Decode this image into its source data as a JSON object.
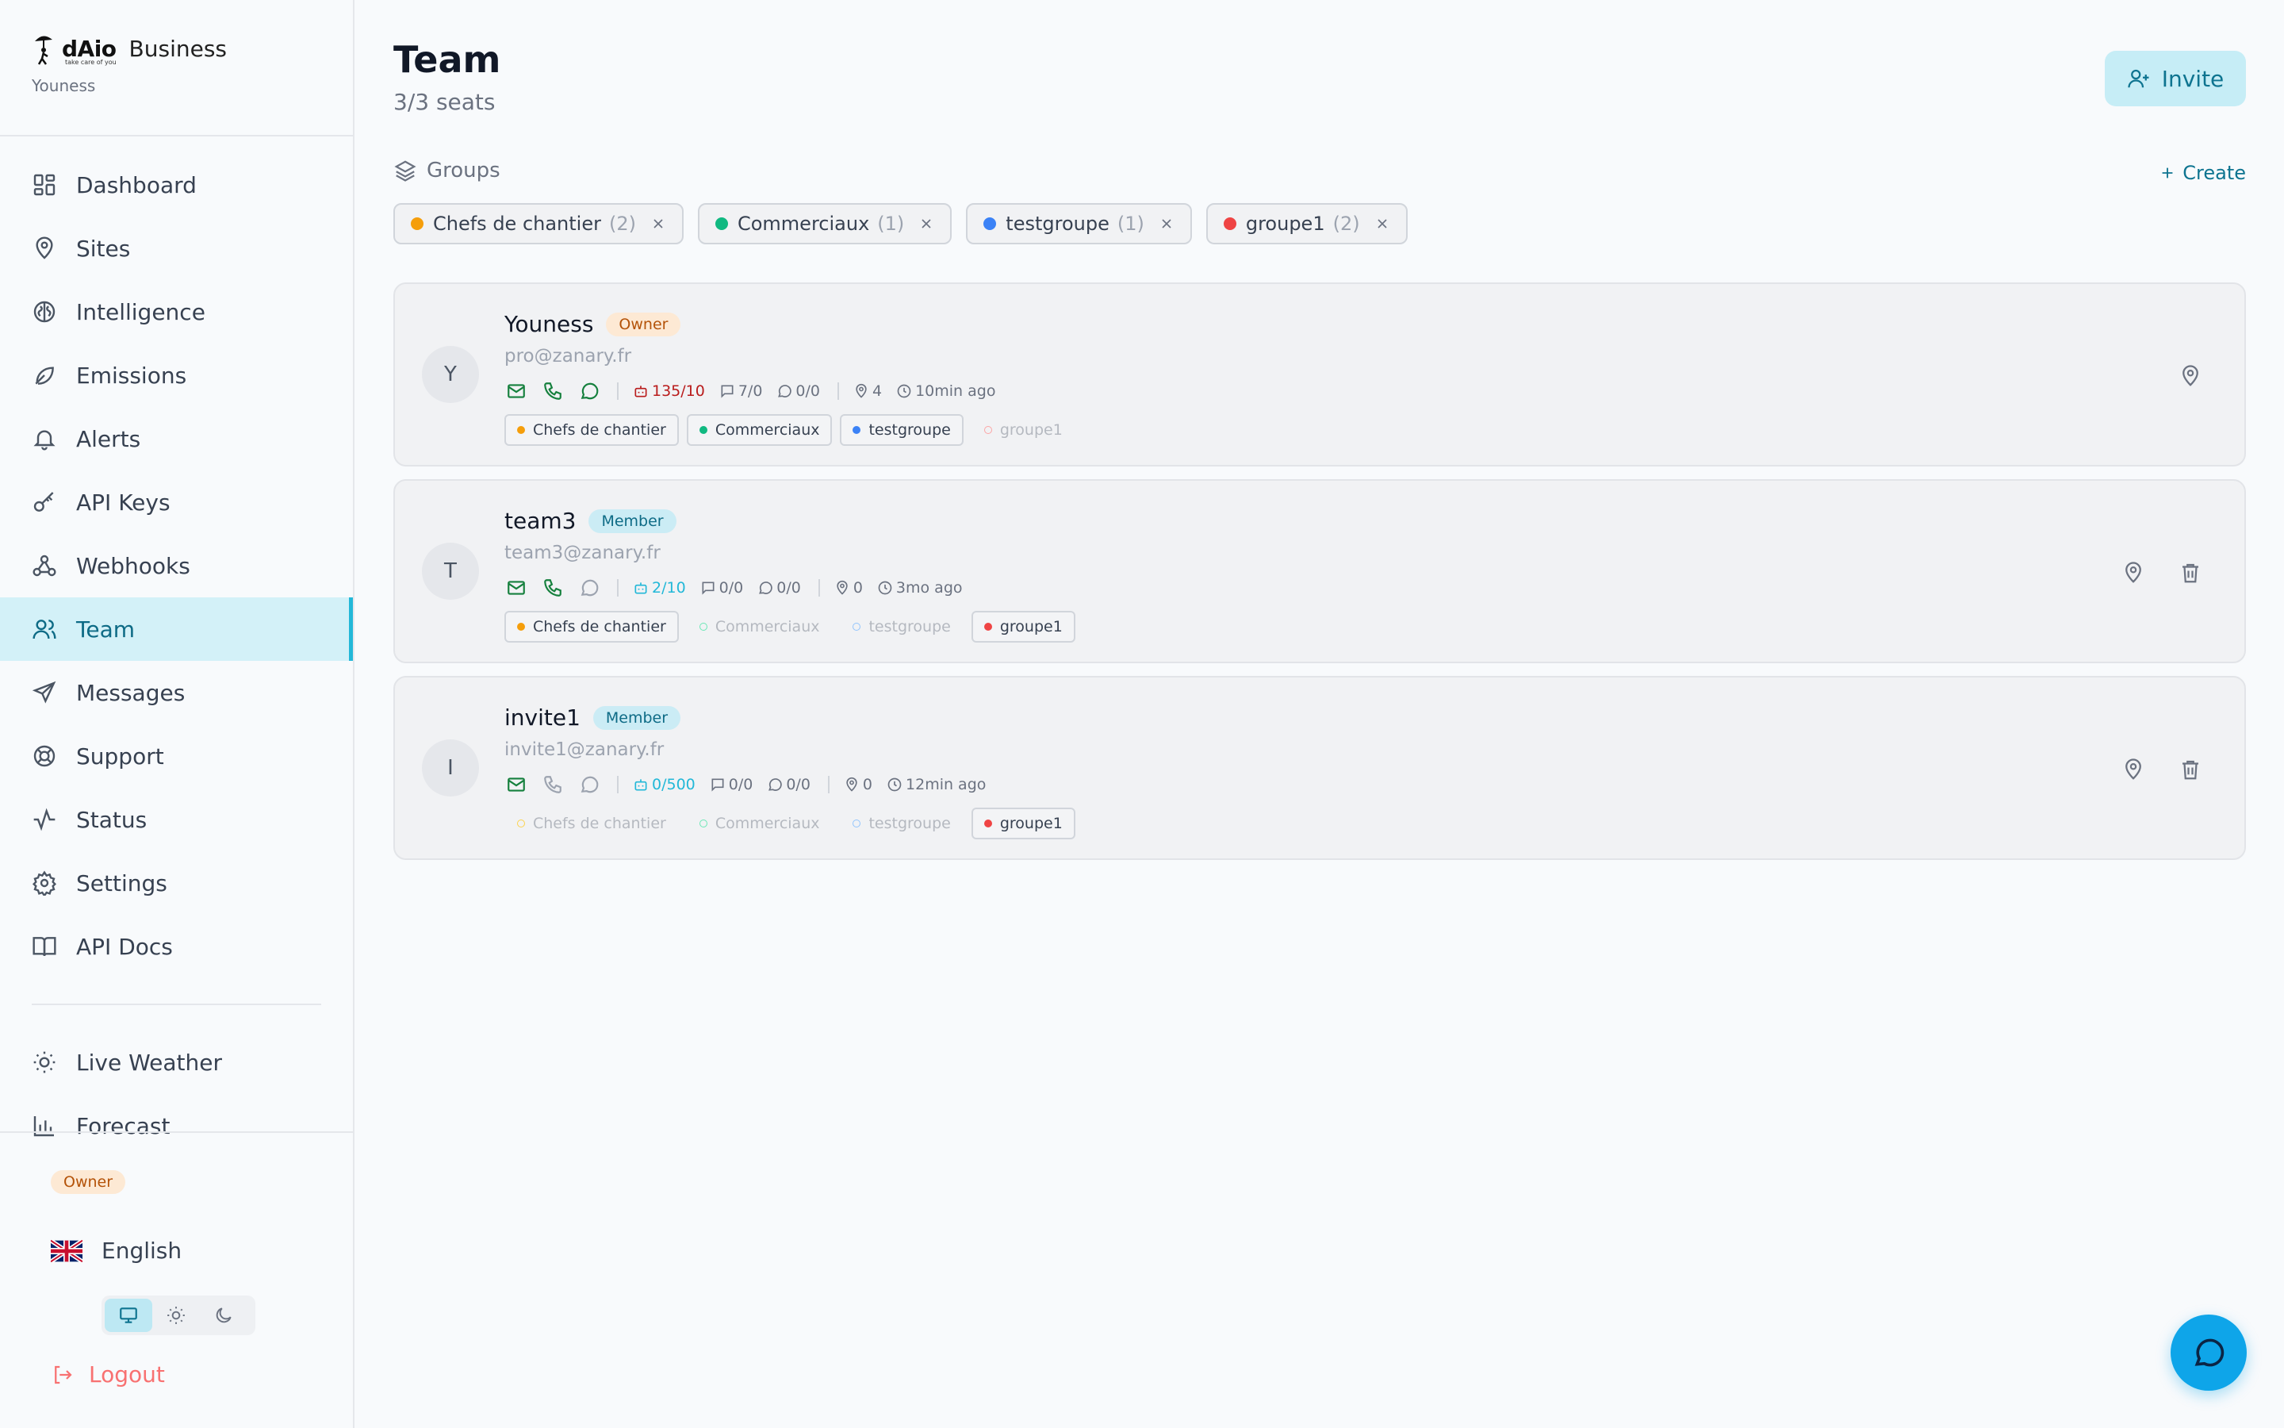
{
  "brand": {
    "logo_text": "dAio",
    "tagline": "take care of you",
    "plan": "Business",
    "user": "Youness"
  },
  "nav": {
    "items": [
      {
        "label": "Dashboard",
        "icon": "dashboard-icon"
      },
      {
        "label": "Sites",
        "icon": "map-pin-icon"
      },
      {
        "label": "Intelligence",
        "icon": "brain-icon"
      },
      {
        "label": "Emissions",
        "icon": "leaf-icon"
      },
      {
        "label": "Alerts",
        "icon": "bell-icon"
      },
      {
        "label": "API Keys",
        "icon": "key-icon"
      },
      {
        "label": "Webhooks",
        "icon": "webhook-icon"
      },
      {
        "label": "Team",
        "icon": "users-icon",
        "active": true
      },
      {
        "label": "Messages",
        "icon": "send-icon"
      },
      {
        "label": "Support",
        "icon": "lifebuoy-icon"
      },
      {
        "label": "Status",
        "icon": "activity-icon"
      },
      {
        "label": "Settings",
        "icon": "gear-icon"
      },
      {
        "label": "API Docs",
        "icon": "book-icon"
      }
    ],
    "extra": [
      {
        "label": "Live Weather",
        "icon": "sun-icon"
      },
      {
        "label": "Forecast",
        "icon": "bar-chart-icon"
      }
    ]
  },
  "footer": {
    "role": "Owner",
    "language": "English",
    "logout": "Logout",
    "theme_active": "system"
  },
  "page": {
    "title": "Team",
    "seats": "3/3 seats",
    "invite": "Invite",
    "groups_label": "Groups",
    "create": "Create"
  },
  "groups": [
    {
      "name": "Chefs de chantier",
      "count": "(2)",
      "color": "#f59e0b"
    },
    {
      "name": "Commerciaux",
      "count": "(1)",
      "color": "#10b981"
    },
    {
      "name": "testgroupe",
      "count": "(1)",
      "color": "#3b82f6"
    },
    {
      "name": "groupe1",
      "count": "(2)",
      "color": "#ef4444"
    }
  ],
  "members": [
    {
      "initial": "Y",
      "name": "Youness",
      "role": "Owner",
      "email": "pro@zanary.fr",
      "channels": {
        "email": true,
        "phone": true,
        "whatsapp": true
      },
      "usage": "135/10",
      "usage_state": "over",
      "sms": "7/0",
      "chat": "0/0",
      "sites": "4",
      "last_seen": "10min ago",
      "groups": [
        true,
        true,
        true,
        false
      ],
      "can_delete": false
    },
    {
      "initial": "T",
      "name": "team3",
      "role": "Member",
      "email": "team3@zanary.fr",
      "channels": {
        "email": true,
        "phone": true,
        "whatsapp": false
      },
      "usage": "2/10",
      "usage_state": "ok",
      "sms": "0/0",
      "chat": "0/0",
      "sites": "0",
      "last_seen": "3mo ago",
      "groups": [
        true,
        false,
        false,
        true
      ],
      "can_delete": true
    },
    {
      "initial": "I",
      "name": "invite1",
      "role": "Member",
      "email": "invite1@zanary.fr",
      "channels": {
        "email": true,
        "phone": false,
        "whatsapp": false
      },
      "usage": "0/500",
      "usage_state": "ok",
      "sms": "0/0",
      "chat": "0/0",
      "sites": "0",
      "last_seen": "12min ago",
      "groups": [
        false,
        false,
        false,
        true
      ],
      "can_delete": true
    }
  ]
}
